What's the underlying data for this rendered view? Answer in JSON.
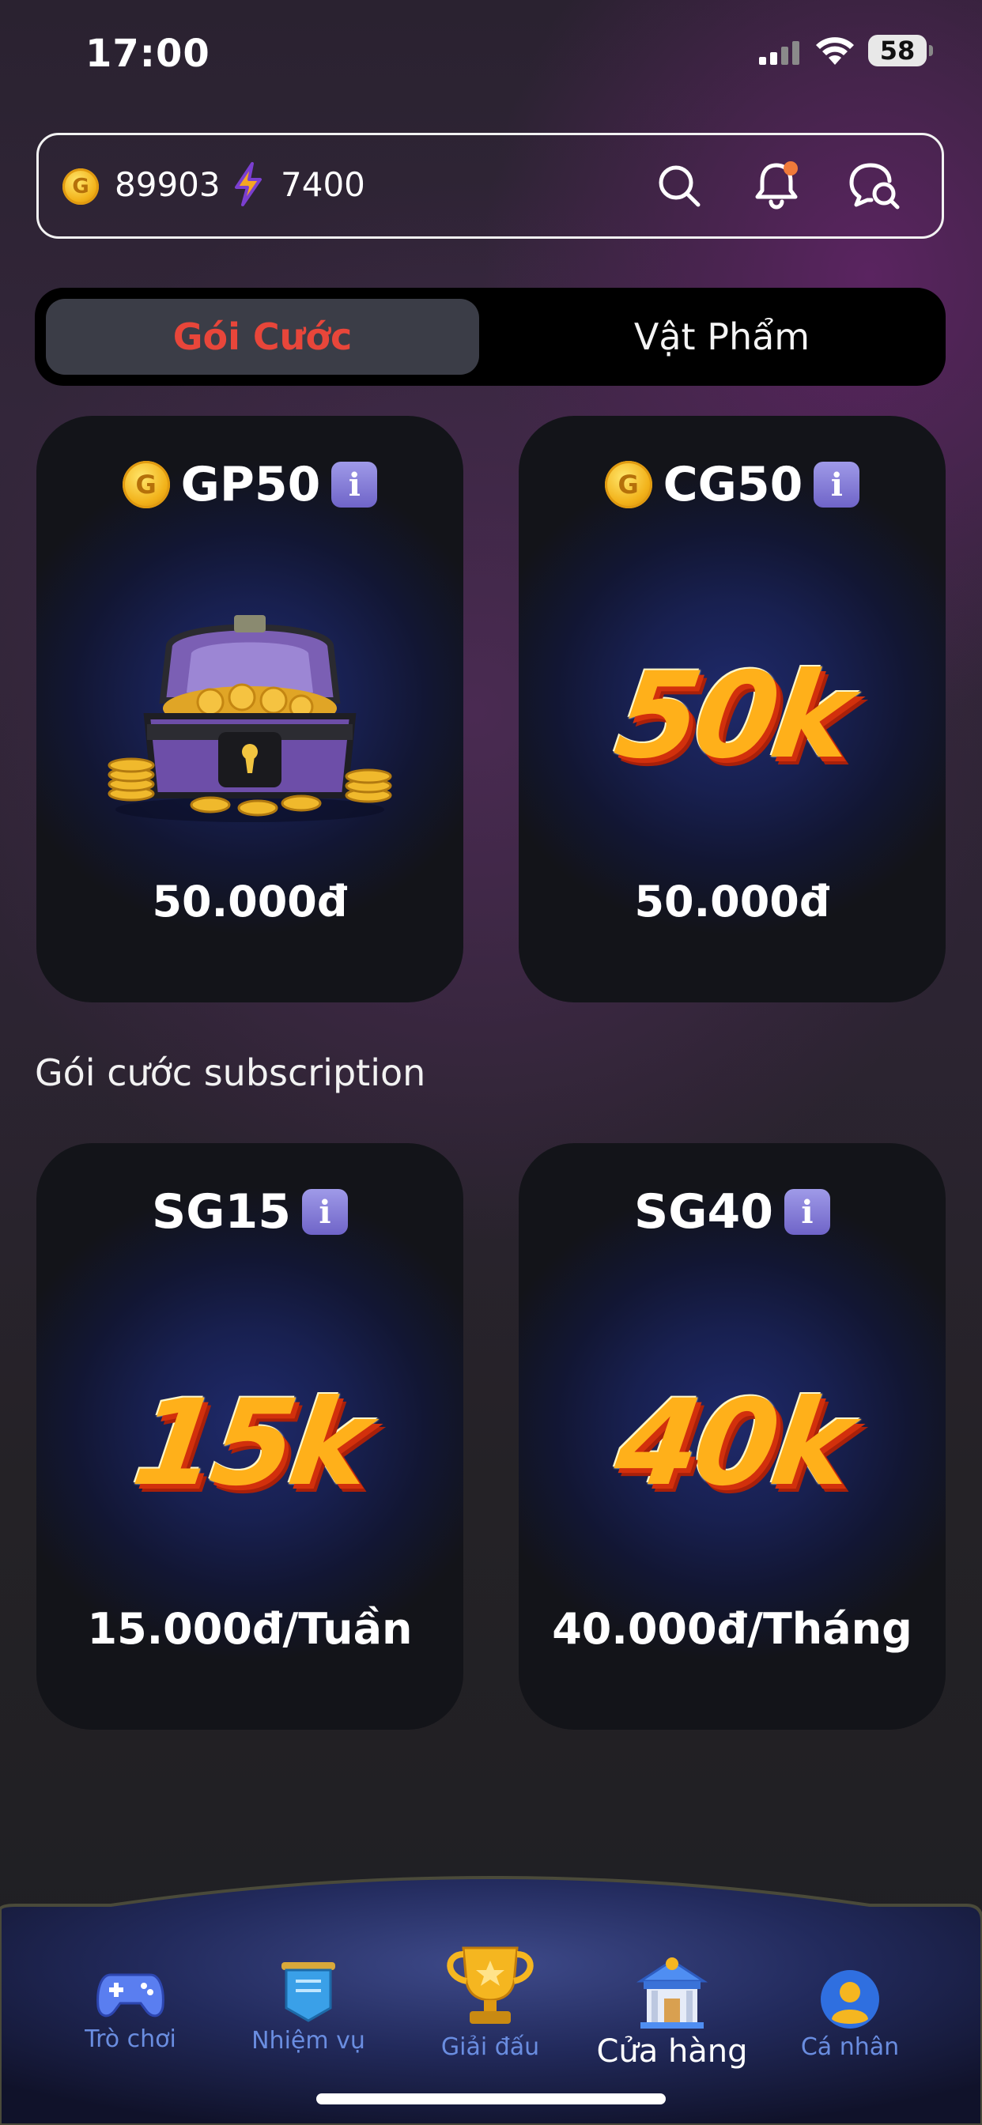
{
  "status": {
    "time": "17:00",
    "battery": "58"
  },
  "topbar": {
    "coins": "89903",
    "energy": "7400"
  },
  "tabs": [
    {
      "label": "Gói Cước"
    },
    {
      "label": "Vật Phẩm"
    }
  ],
  "cards": [
    {
      "code": "GP50",
      "price": "50.000đ"
    },
    {
      "code": "CG50",
      "art_text": "50k",
      "price": "50.000đ"
    },
    {
      "code": "SG15",
      "art_text": "15k",
      "price": "15.000đ/Tuần"
    },
    {
      "code": "SG40",
      "art_text": "40k",
      "price": "40.000đ/Tháng"
    }
  ],
  "section_title": "Gói cước subscription",
  "info_glyph": "i",
  "coin_glyph": "G",
  "nav": [
    {
      "label": "Trò chơi",
      "icon": "gamepad-icon"
    },
    {
      "label": "Nhiệm vụ",
      "icon": "quest-banner-icon"
    },
    {
      "label": "Giải đấu",
      "icon": "trophy-icon"
    },
    {
      "label": "Cửa hàng",
      "icon": "store-icon",
      "active": true
    },
    {
      "label": "Cá nhân",
      "icon": "profile-icon"
    }
  ],
  "colors": {
    "accent_red": "#e8463a",
    "nav_blue": "#6a8de0",
    "card_bg": "#131419"
  }
}
